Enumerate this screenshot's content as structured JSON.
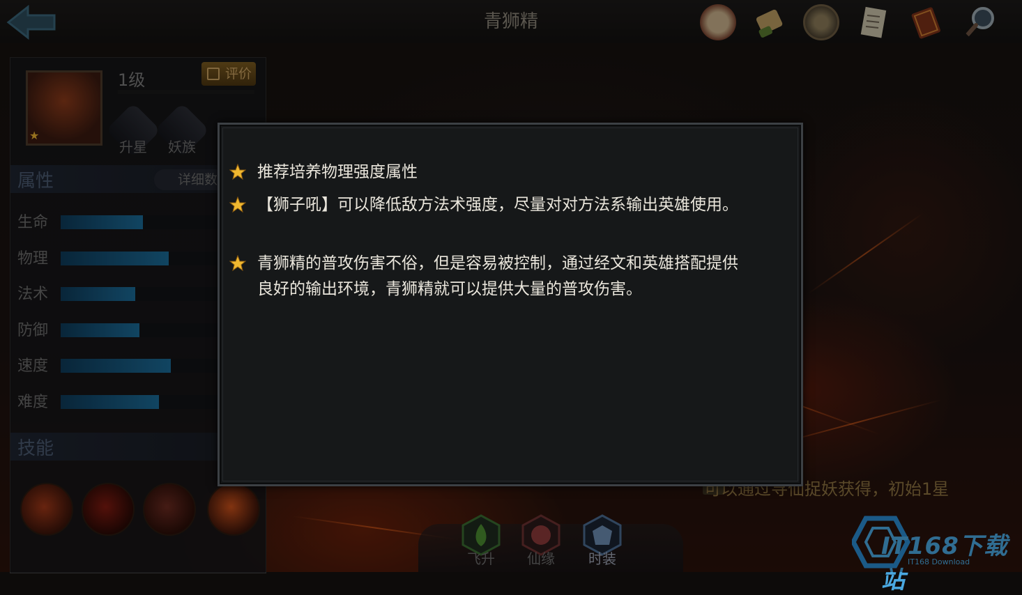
{
  "header": {
    "title": "青狮精",
    "icons": [
      "seal-icon",
      "scroll-icon",
      "coin-icon",
      "document-icon",
      "book-icon",
      "magnifier-icon"
    ]
  },
  "hero": {
    "level": "1级",
    "review_label": "评价",
    "badges": [
      "升星",
      "妖族"
    ]
  },
  "attributes": {
    "title": "属性",
    "detail_label": "详细数",
    "items": [
      {
        "label": "生命",
        "value": 0.42
      },
      {
        "label": "物理",
        "value": 0.55
      },
      {
        "label": "法术",
        "value": 0.38
      },
      {
        "label": "防御",
        "value": 0.4
      },
      {
        "label": "速度",
        "value": 0.56
      },
      {
        "label": "难度",
        "value": 0.5
      }
    ]
  },
  "skills": {
    "title": "技能"
  },
  "bottom_tabs": [
    "飞升",
    "仙缘",
    "时装"
  ],
  "obtain_text": "可以通过寻仙捉妖获得，初始1星",
  "dialog": {
    "tips": [
      "推荐培养物理强度属性",
      "【狮子吼】可以降低敌方法术强度，尽量对对方法系输出英雄使用。",
      "青狮精的普攻伤害不俗，但是容易被控制，通过经文和英雄搭配提供良好的输出环境，青狮精就可以提供大量的普攻伤害。"
    ]
  },
  "watermark": {
    "text": "IT168下载站",
    "sub": "IT168 Download"
  },
  "colors": {
    "accent_blue": "#1b6a96",
    "star_gold": "#e8b030",
    "dialog_bg": "#161819"
  }
}
